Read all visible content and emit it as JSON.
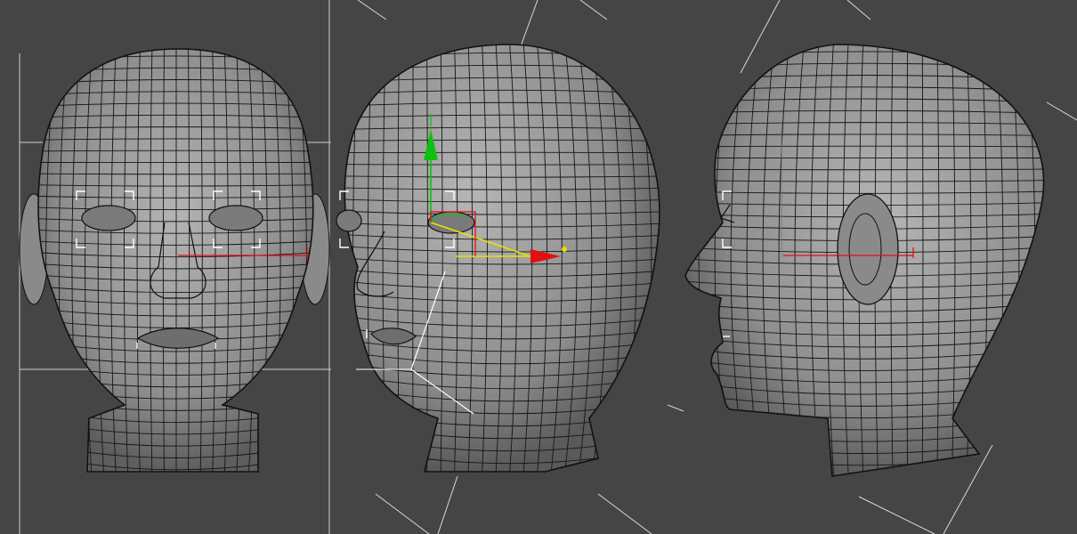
{
  "viewports": [
    {
      "id": "front",
      "view": "front"
    },
    {
      "id": "three-quarter",
      "view": "perspective"
    },
    {
      "id": "side",
      "view": "left"
    }
  ],
  "colors": {
    "background": "#454545",
    "mesh_fill": "#9a9a9a",
    "wire": "#111111",
    "grid_line": "#d8d8d8",
    "gizmo_x": "#e01010",
    "gizmo_y": "#10c010",
    "gizmo_z": "#2060ff",
    "selection": "#ffffff",
    "gizmo_center": "#e8e000"
  },
  "icons": [
    "transform-gizmo-icon",
    "selection-bracket-icon"
  ]
}
